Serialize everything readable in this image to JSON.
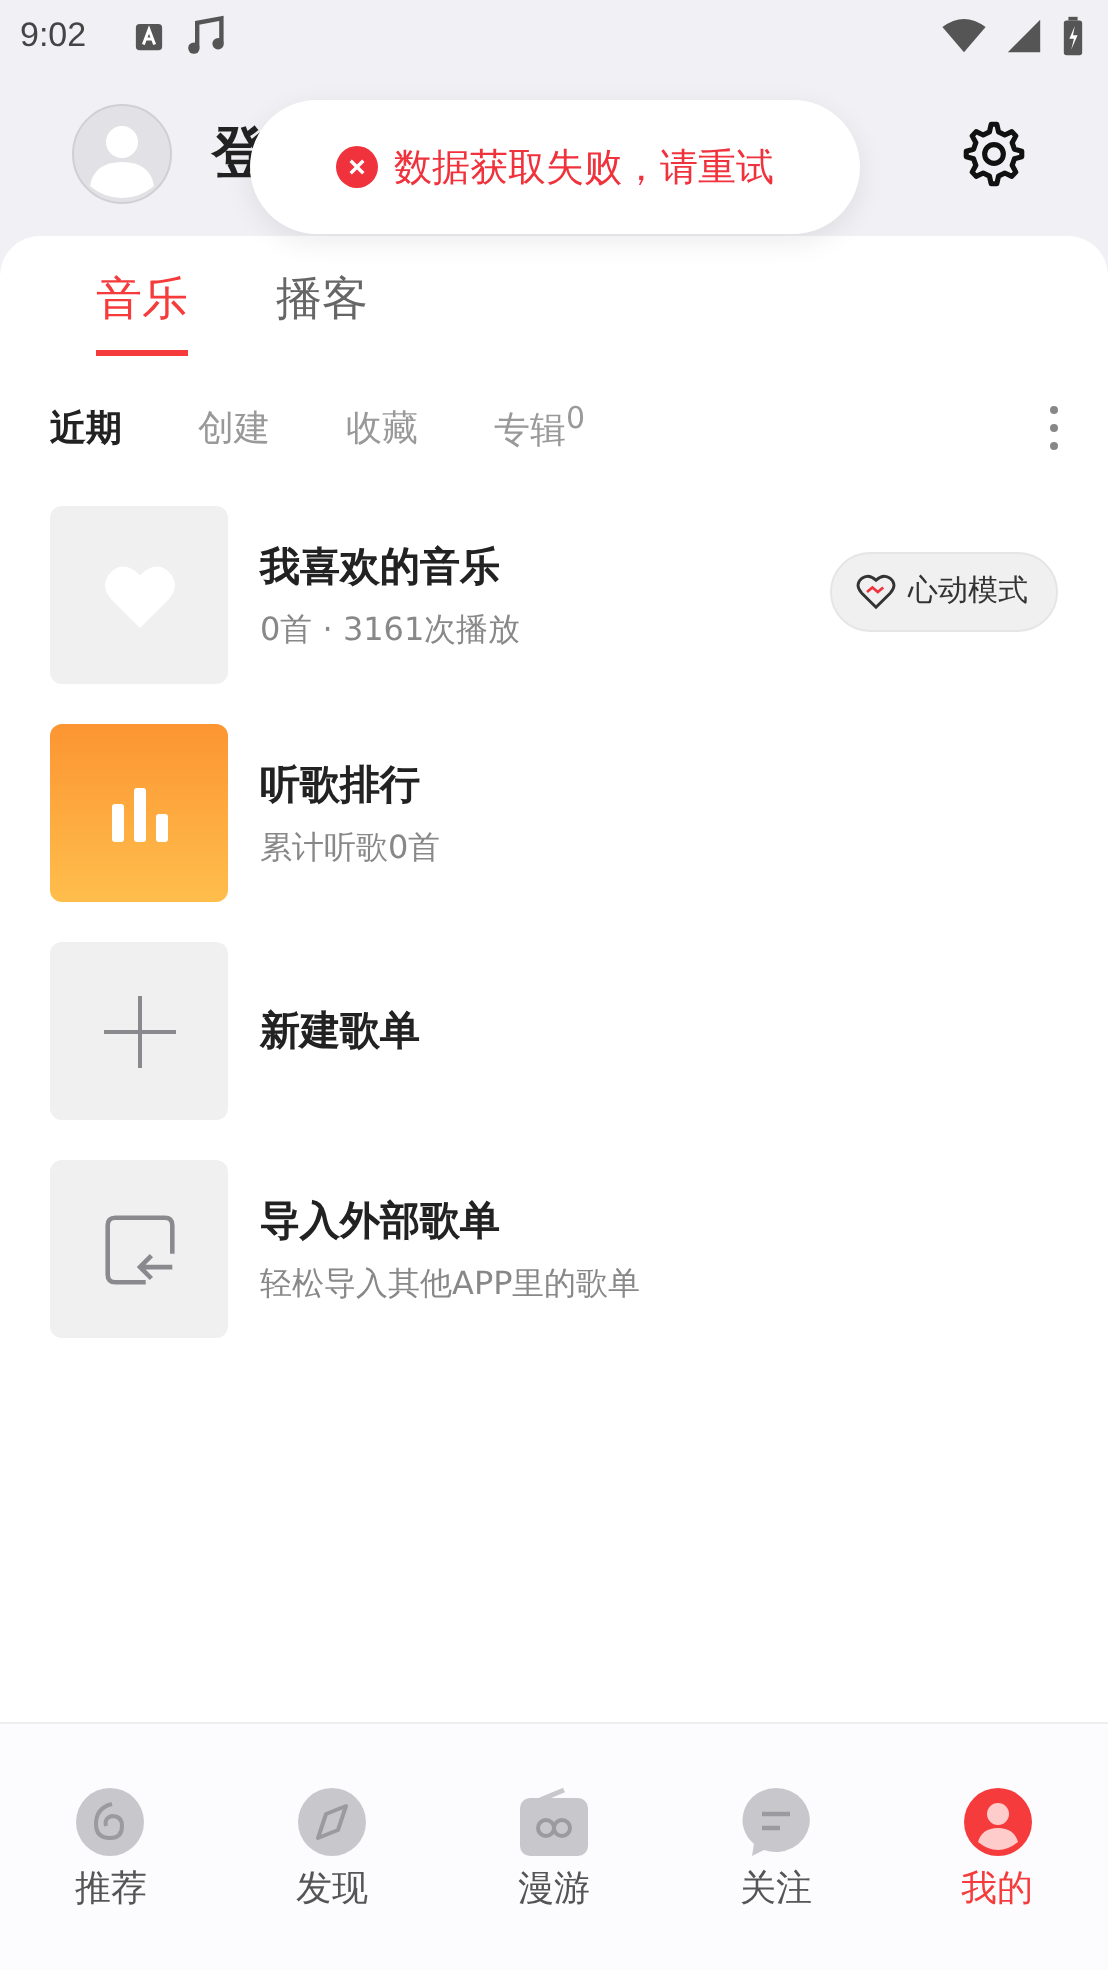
{
  "status_bar": {
    "time": "9:02"
  },
  "header": {
    "user_name": "登"
  },
  "toast": {
    "kind": "error",
    "message": "数据获取失败，请重试"
  },
  "tabs": [
    {
      "label": "音乐",
      "selected": true
    },
    {
      "label": "播客",
      "selected": false
    }
  ],
  "sub_tabs": [
    {
      "label": "近期",
      "selected": true
    },
    {
      "label": "创建",
      "selected": false
    },
    {
      "label": "收藏",
      "selected": false
    },
    {
      "label": "专辑$^{0}$",
      "selected": false
    }
  ],
  "playlists": [
    {
      "kind": "liked",
      "title": "我喜欢的音乐",
      "subtitle": "0首 · 3161次播放",
      "action": "心动模式"
    },
    {
      "kind": "rank",
      "title": "听歌排行",
      "subtitle": "累计听歌0首"
    },
    {
      "kind": "create",
      "title": "新建歌单"
    },
    {
      "kind": "import",
      "title": "导入外部歌单",
      "subtitle": "轻松导入其他APP里的歌单"
    }
  ],
  "bottom_nav": [
    {
      "kind": "recommend",
      "label": "推荐",
      "selected": false
    },
    {
      "kind": "discover",
      "label": "发现",
      "selected": false
    },
    {
      "kind": "roam",
      "label": "漫游",
      "selected": false
    },
    {
      "kind": "follow",
      "label": "关注",
      "selected": false
    },
    {
      "kind": "mine",
      "label": "我的",
      "selected": true
    }
  ]
}
